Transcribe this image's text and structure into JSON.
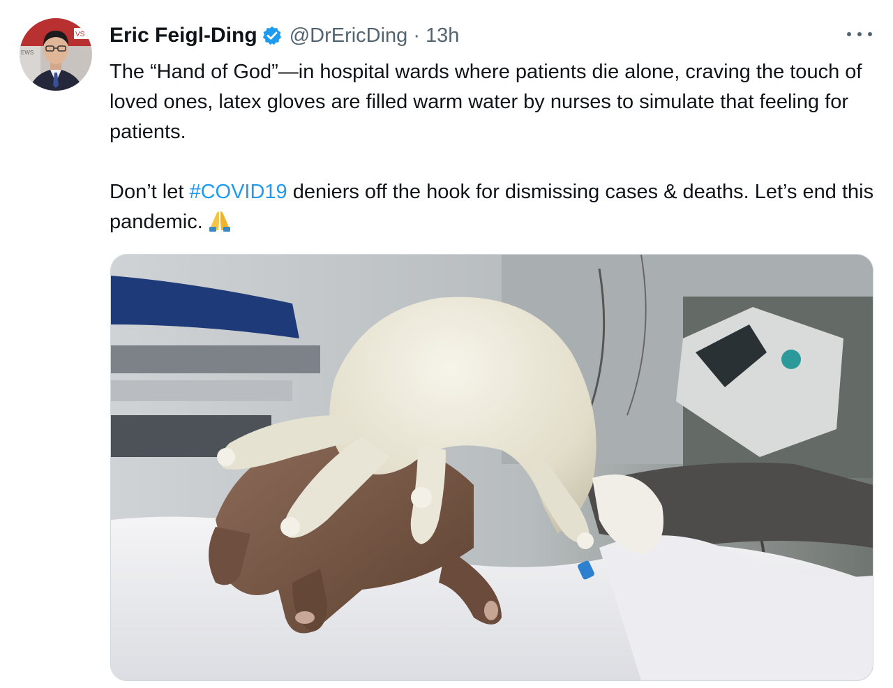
{
  "tweet": {
    "display_name": "Eric Feigl-Ding",
    "handle": "@DrEricDing",
    "separator": "·",
    "time": "13h",
    "verified_icon": "verified-badge-icon",
    "more_icon": "more-options-icon",
    "body": {
      "paragraph1": "The “Hand of God”—in hospital wards where patients die alone, craving the touch of loved ones, latex gloves are filled warm water by nurses to simulate that feeling for patients.",
      "p2_before": "Don’t let ",
      "hashtag": "#COVID19",
      "p2_after": " deniers off the hook for dismissing cases & deaths. Let’s end this pandemic.",
      "emoji": "folded-hands-emoji"
    },
    "avatar": {
      "badge_text": "VS • I",
      "side_text": "EWS"
    },
    "media": {
      "description_icon": "photo-hospital-glove-hand",
      "colors": {
        "glove": "#e9e6d8",
        "skin": "#7a5a48",
        "sheet": "#f2f2f4",
        "blanket": "#1f3a78"
      }
    }
  },
  "colors": {
    "accent": "#1d9bf0",
    "secondary_text": "#536471",
    "primary_text": "#0f1419"
  }
}
